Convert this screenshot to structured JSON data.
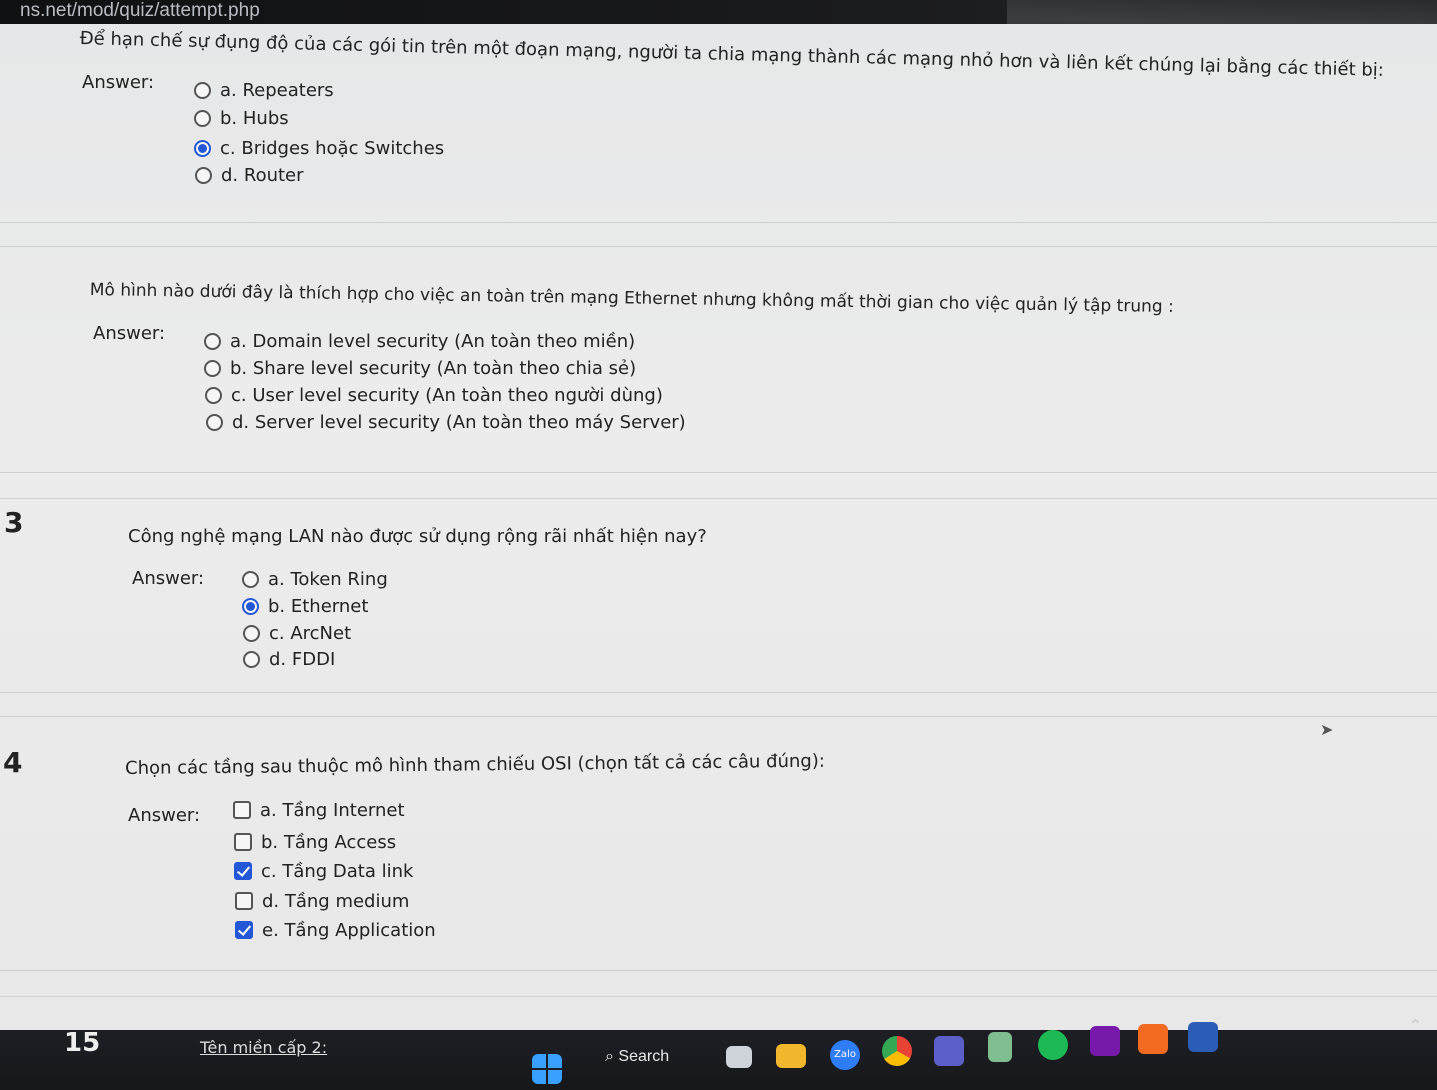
{
  "browser": {
    "url": "ns.net/mod/quiz/attempt.php"
  },
  "questions": [
    {
      "text": "Để hạn chế sự đụng độ của các gói tin trên một đoạn mạng, người ta chia mạng thành các mạng nhỏ hơn và liên kết chúng lại bằng các thiết bị:",
      "answer_label": "Answer:",
      "options": [
        "a. Repeaters",
        "b. Hubs",
        "c. Bridges hoặc Switches",
        "d. Router"
      ],
      "selected": [
        false,
        false,
        true,
        false
      ]
    },
    {
      "text": "Mô hình nào dưới đây là thích hợp cho việc an toàn trên mạng Ethernet nhưng không mất thời gian cho việc quản lý tập trung :",
      "answer_label": "Answer:",
      "options": [
        "a. Domain level security (An toàn theo miền)",
        "b. Share level security (An toàn theo chia sẻ)",
        "c. User level security (An toàn theo người dùng)",
        "d. Server level security (An toàn theo máy Server)"
      ],
      "selected": [
        false,
        false,
        false,
        false
      ]
    },
    {
      "number": "3",
      "text": "Công nghệ mạng LAN nào được sử dụng rộng rãi nhất hiện nay?",
      "answer_label": "Answer:",
      "options": [
        "a. Token Ring",
        "b. Ethernet",
        "c. ArcNet",
        "d. FDDI"
      ],
      "selected": [
        false,
        true,
        false,
        false
      ]
    },
    {
      "number": "4",
      "text": "Chọn các tầng sau thuộc mô hình tham chiếu OSI (chọn tất cả các câu đúng):",
      "answer_label": "Answer:",
      "options": [
        "a. Tầng Internet",
        "b. Tầng Access",
        "c. Tầng Data link",
        "d. Tầng medium",
        "e. Tầng Application"
      ],
      "selected": [
        false,
        false,
        true,
        false,
        true
      ]
    },
    {
      "number": "15",
      "text": "Tên miền cấp 2:"
    }
  ],
  "taskbar": {
    "search_label": "Search",
    "apps": [
      "windows-start-icon",
      "search-icon",
      "file-manager-icon",
      "folder-icon",
      "zalo-icon",
      "chrome-icon",
      "teams-icon",
      "notepad-icon",
      "spotify-icon",
      "onenote-icon",
      "app-g-icon",
      "word-icon"
    ]
  },
  "colors": {
    "accent": "#2457d6",
    "page_bg": "#e9eaea",
    "taskbar_bg": "#1b1d22"
  }
}
